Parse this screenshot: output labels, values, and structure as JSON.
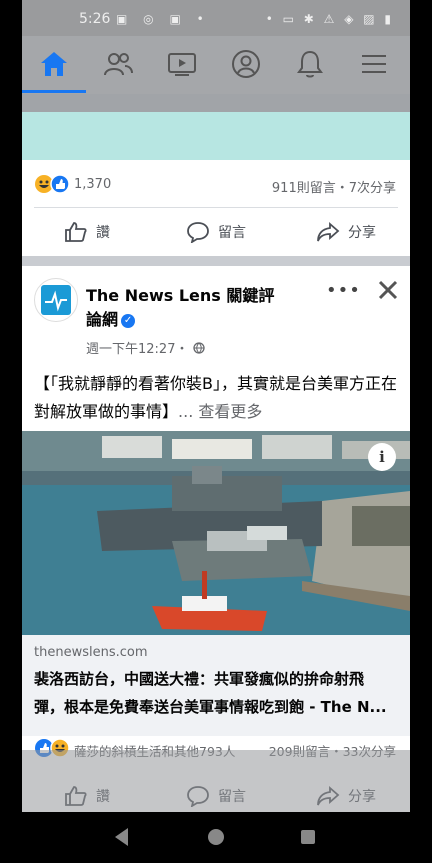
{
  "status_bar": {
    "time": "5:26"
  },
  "nav": {
    "items": [
      "home-icon",
      "friends-icon",
      "watch-icon",
      "profile-icon",
      "notifications-icon",
      "menu-icon"
    ],
    "accent": "#1877f2"
  },
  "post1": {
    "reaction_count": "1,370",
    "comments_shares": "911則留言・7次分享",
    "actions": {
      "like": "讚",
      "comment": "留言",
      "share": "分享"
    }
  },
  "post2": {
    "page_name": "The News Lens 關鍵評論網",
    "timestamp": "週一下午12:27・",
    "caption": "【「我就靜靜的看著你裝B」，其實就是台美軍方正在對解放軍做的事情】",
    "see_more": "... 查看更多",
    "link": {
      "domain": "thenewslens.com",
      "headline_line1": "裴洛西訪台，中國送大禮：共軍發瘋似的拚命射飛",
      "headline_line2": "彈，根本是免費奉送台美軍事情報吃到飽 - The N..."
    },
    "reactions_summary": "薩莎的斜槓生活和其他793人",
    "comments_shares": "209則留言・33次分享",
    "actions": {
      "like": "讚",
      "comment": "留言",
      "share": "分享"
    }
  }
}
